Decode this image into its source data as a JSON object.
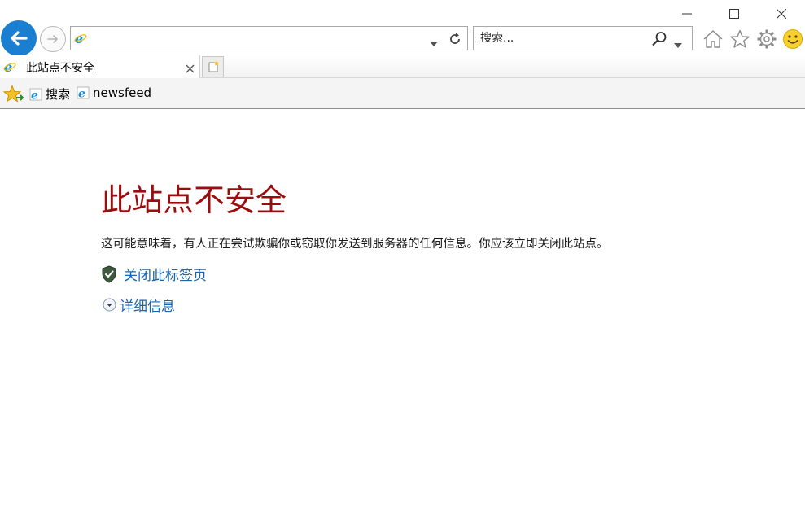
{
  "address_bar": {
    "url": ""
  },
  "search": {
    "placeholder": "搜索..."
  },
  "tab": {
    "title": "此站点不安全"
  },
  "favorites": {
    "items": [
      {
        "label": "搜索"
      },
      {
        "label": "newsfeed"
      }
    ]
  },
  "page": {
    "title": "此站点不安全",
    "description": "这可能意味着，有人正在尝试欺骗你或窃取你发送到服务器的任何信息。你应该立即关闭此站点。",
    "close_tab_link": "关闭此标签页",
    "details_link": "详细信息"
  },
  "colors": {
    "title_red": "#9b0d0d",
    "link_blue": "#1565b0",
    "back_button_blue": "#1a7fd1"
  }
}
